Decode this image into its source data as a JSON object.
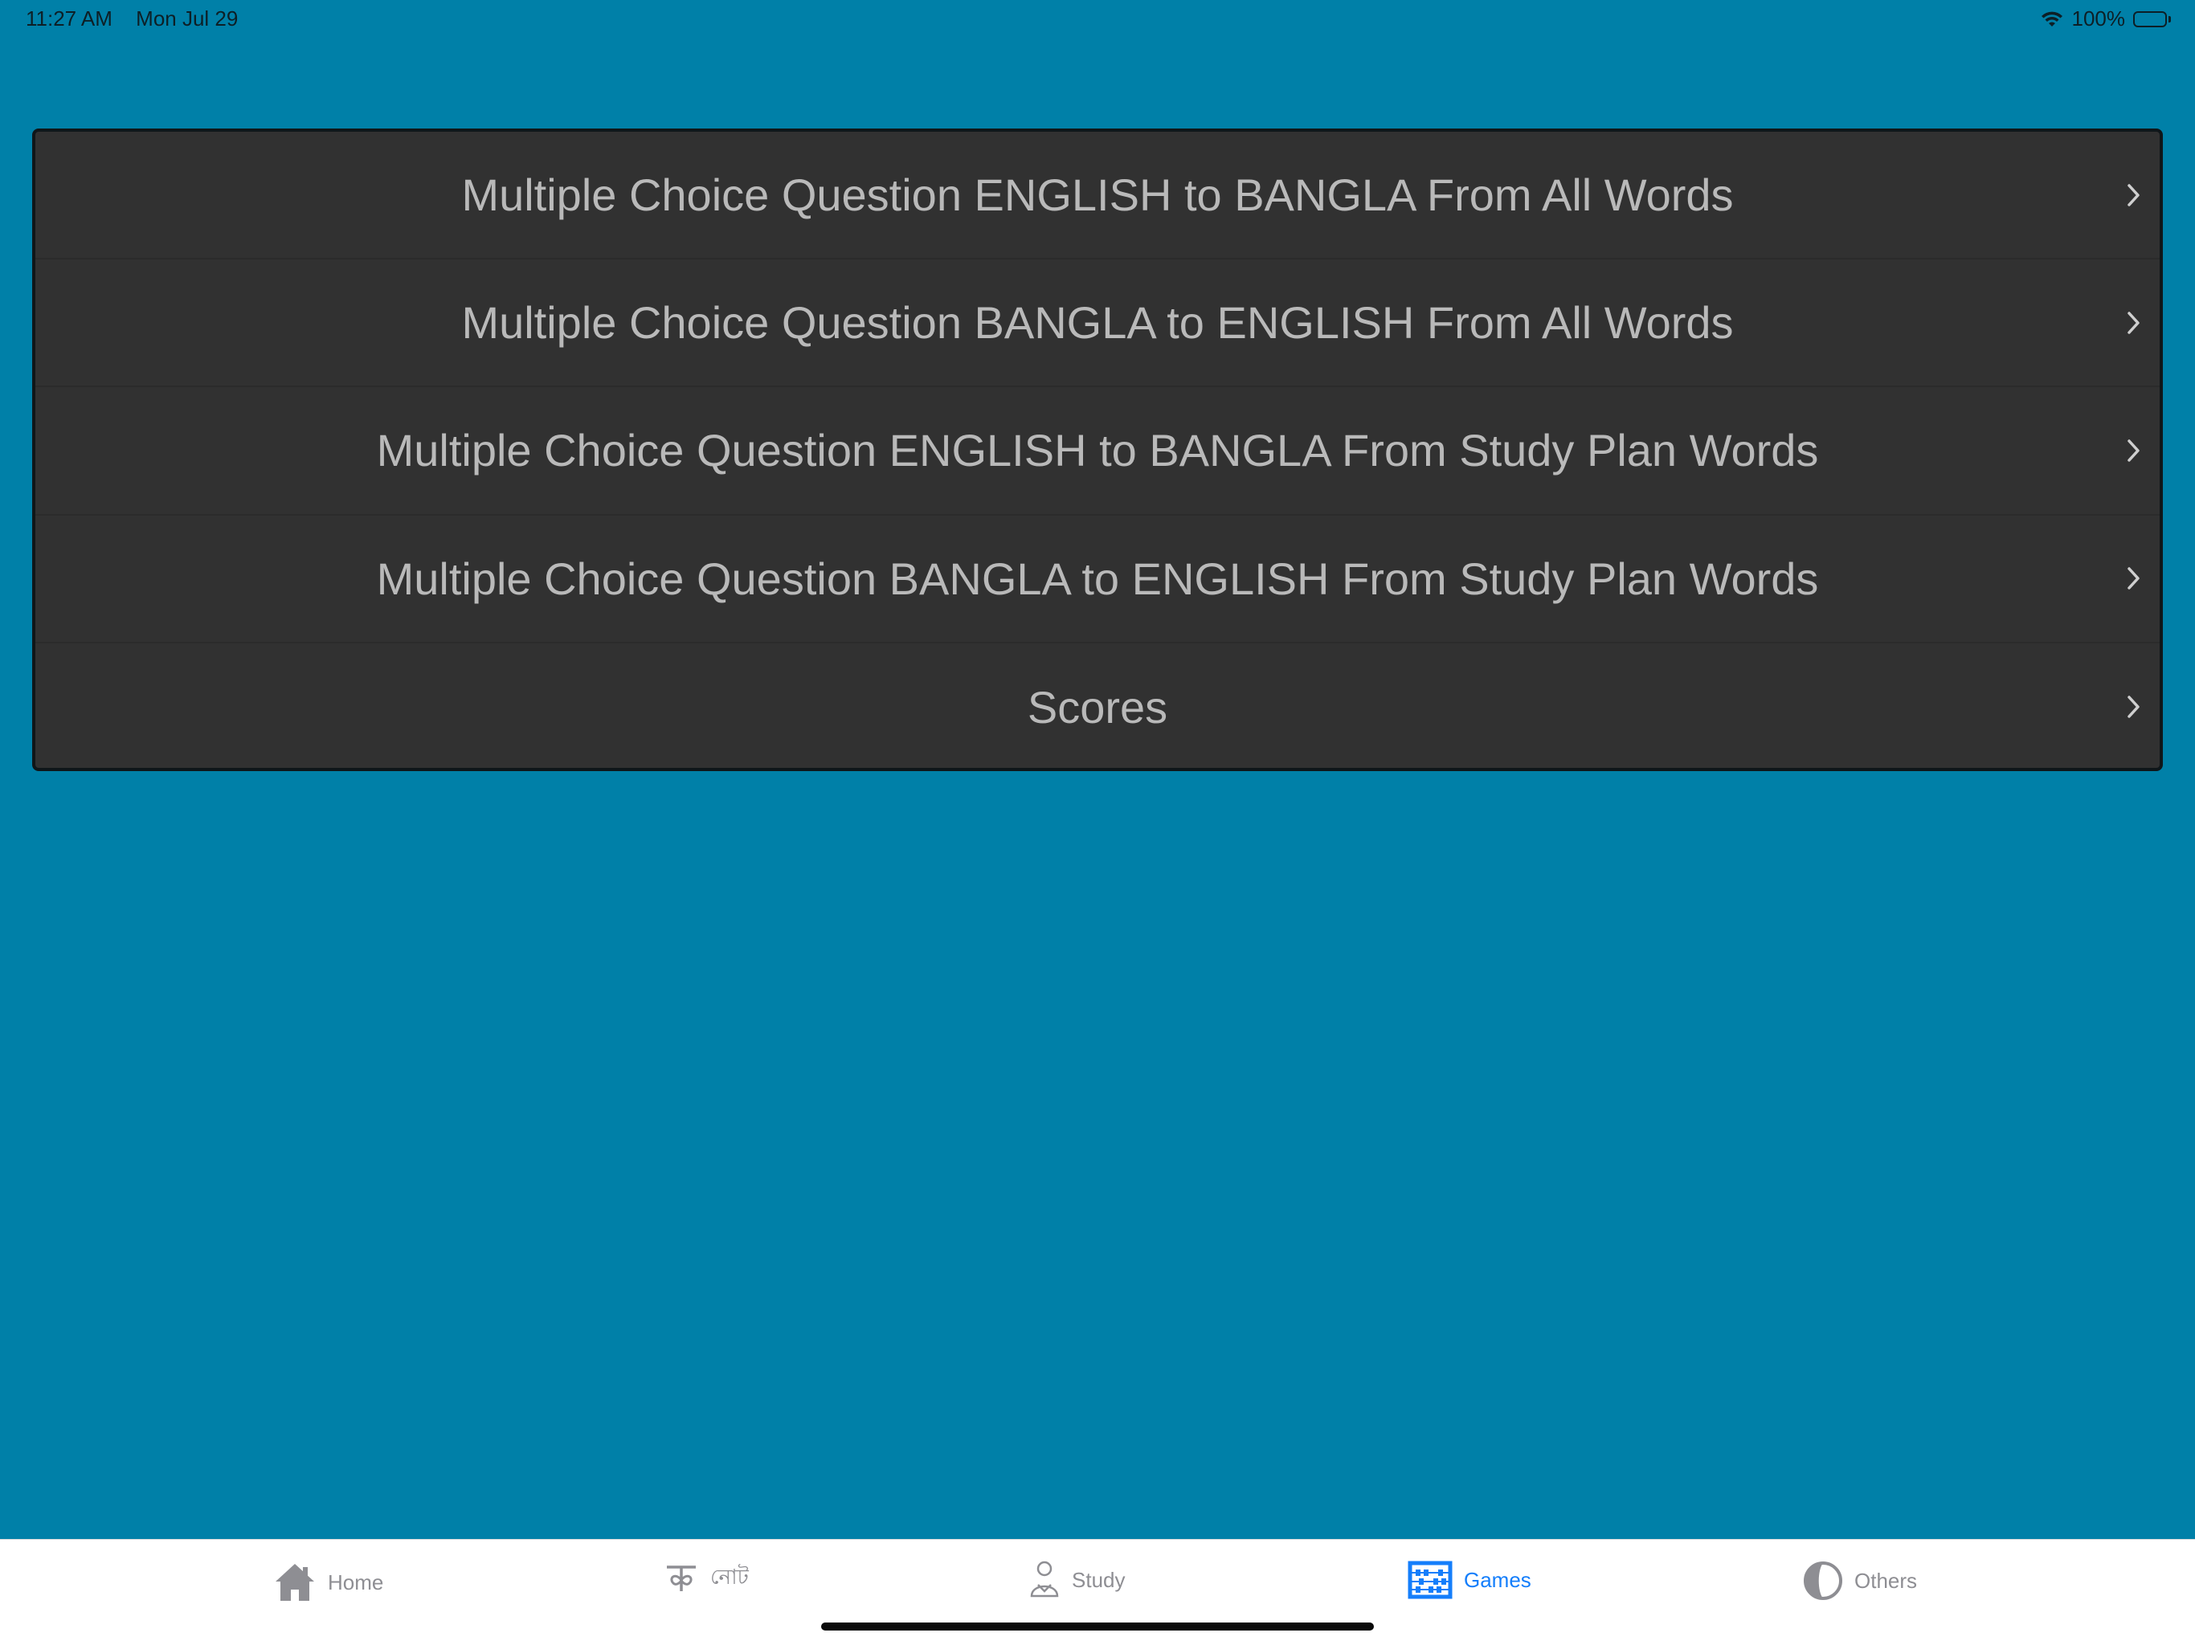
{
  "status_bar": {
    "time": "11:27 AM",
    "date": "Mon Jul 29",
    "battery_text": "100%"
  },
  "menu": {
    "items": [
      {
        "label": "Multiple Choice Question ENGLISH to BANGLA From All Words"
      },
      {
        "label": "Multiple Choice Question BANGLA to ENGLISH From All Words"
      },
      {
        "label": "Multiple Choice Question ENGLISH to BANGLA From Study Plan Words"
      },
      {
        "label": "Multiple Choice Question BANGLA to ENGLISH From Study Plan Words"
      },
      {
        "label": "Scores"
      }
    ]
  },
  "tab_bar": {
    "tabs": [
      {
        "label": "Home",
        "icon": "home-icon"
      },
      {
        "label": "নোট",
        "icon": "bangla-letter-icon"
      },
      {
        "label": "Study",
        "icon": "person-icon"
      },
      {
        "label": "Games",
        "icon": "abacus-icon",
        "active": true
      },
      {
        "label": "Others",
        "icon": "half-circle-icon"
      }
    ]
  },
  "colors": {
    "background": "#0080a8",
    "list_background": "#313131",
    "list_text": "#b9b9b9",
    "tab_active": "#147efb",
    "tab_inactive": "#8e8e93"
  }
}
